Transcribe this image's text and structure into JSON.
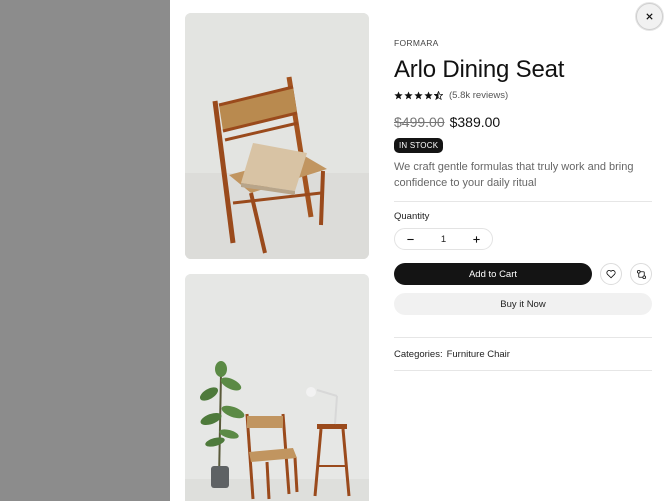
{
  "product": {
    "brand": "FORMARA",
    "title": "Arlo Dining Seat",
    "rating": 4.5,
    "reviews": "(5.8k reviews)",
    "old_price": "$499.00",
    "new_price": "$389.00",
    "stock_badge": "IN STOCK",
    "description": "We craft gentle formulas that truly work and bring confidence to your daily ritual"
  },
  "quantity": {
    "label": "Quantity",
    "value": "1"
  },
  "actions": {
    "add_to_cart": "Add to Cart",
    "buy_now": "Buy it Now"
  },
  "categories": {
    "label": "Categories:",
    "value": "Furniture Chair"
  },
  "icons": {
    "close": "close-icon",
    "wishlist": "heart-icon",
    "compare": "compare-icon",
    "minus": "minus-icon",
    "plus": "plus-icon"
  },
  "colors": {
    "overlay": "#8c8c8c",
    "primary_button": "#141414",
    "secondary_button": "#f1f1f1",
    "text_muted": "#666666"
  }
}
